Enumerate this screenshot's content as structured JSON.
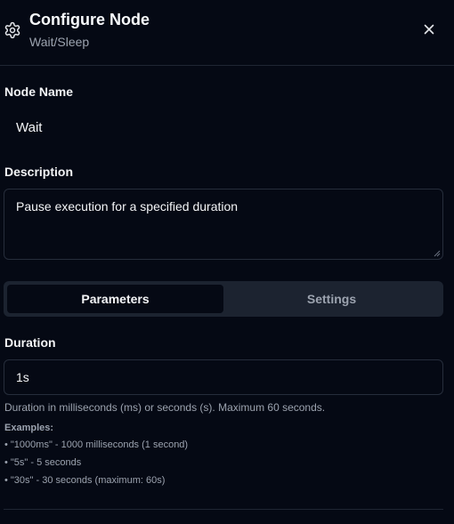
{
  "header": {
    "title": "Configure Node",
    "subtitle": "Wait/Sleep",
    "icon": "gear-icon",
    "close_icon": "close-icon"
  },
  "node_name": {
    "label": "Node Name",
    "value": "Wait"
  },
  "description": {
    "label": "Description",
    "value": "Pause execution for a specified duration"
  },
  "tabs": [
    {
      "label": "Parameters",
      "active": true
    },
    {
      "label": "Settings",
      "active": false
    }
  ],
  "duration": {
    "label": "Duration",
    "value": "1s",
    "help": "Duration in milliseconds (ms) or seconds (s). Maximum 60 seconds.",
    "examples_title": "Examples:",
    "examples": [
      "• \"1000ms\" - 1000 milliseconds (1 second)",
      "• \"5s\" - 5 seconds",
      "• \"30s\" - 30 seconds (maximum: 60s)"
    ]
  },
  "colors": {
    "background": "#050914",
    "surface": "#1c2330",
    "border": "#262d3b",
    "muted_text": "#9ca3af"
  }
}
